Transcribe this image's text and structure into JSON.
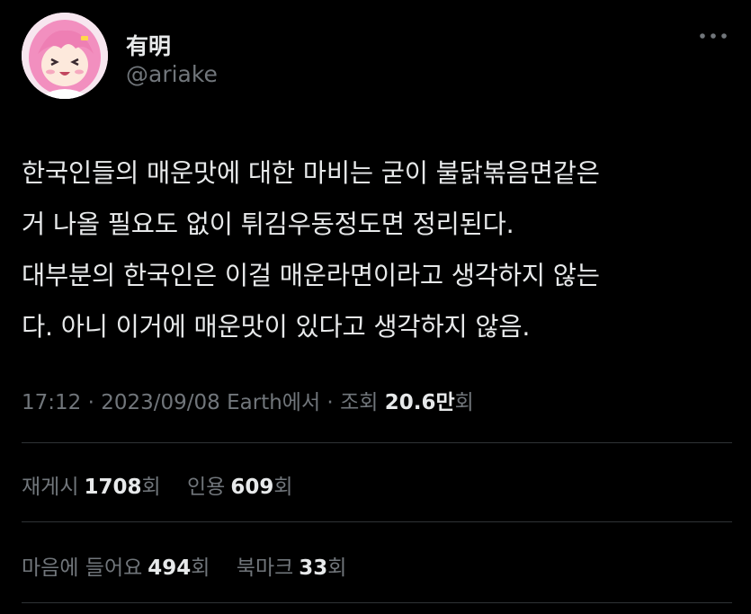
{
  "author": {
    "display_name": "有明",
    "handle": "@ariake",
    "avatar_icon": "avatar-anime-pink-hair"
  },
  "more_icon": "more-horizontal-icon",
  "tweet": {
    "lines": [
      "한국인들의 매운맛에 대한 마비는 굳이 불닭볶음면같은",
      "거 나올 필요도 없이 튀김우동정도면 정리된다.",
      "대부분의 한국인은 이걸 매운라면이라고 생각하지 않는",
      "다. 아니 이거에 매운맛이 있다고 생각하지 않음."
    ]
  },
  "meta": {
    "time": "17:12",
    "separator1": " · ",
    "date": "2023/09/08",
    "source": " Earth에서",
    "separator2": " · ",
    "views_label": "조회 ",
    "views_count": "20.6만",
    "views_unit": "회"
  },
  "stats": {
    "reposts_label": "재게시",
    "reposts_count": "1708",
    "reposts_unit": "회",
    "quotes_label": "인용",
    "quotes_count": "609",
    "quotes_unit": "회",
    "likes_label": "마음에 들어요",
    "likes_count": "494",
    "likes_unit": "회",
    "bookmarks_label": "북마크",
    "bookmarks_count": "33",
    "bookmarks_unit": "회"
  },
  "colors": {
    "background": "#000000",
    "text_primary": "#e7e9ea",
    "text_secondary": "#71767b",
    "divider": "#2f3336",
    "avatar_hair": "#f28fbf"
  }
}
